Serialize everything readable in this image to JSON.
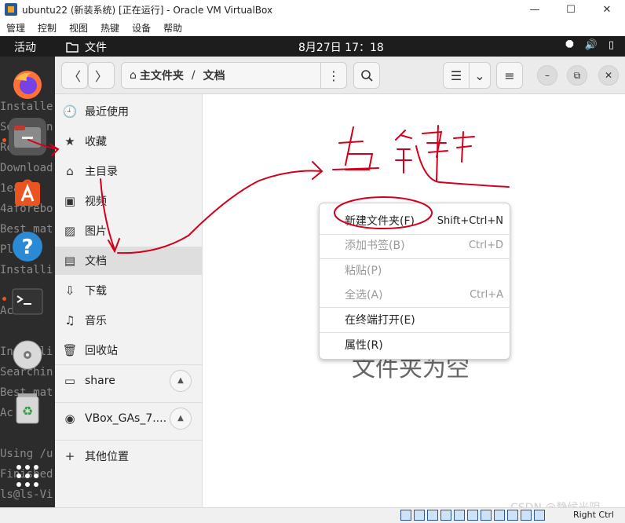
{
  "window": {
    "title": "ubuntu22 (新装系统) [正在运行] - Oracle VM VirtualBox",
    "minimize": "—",
    "maximize": "☐",
    "close": "✕"
  },
  "host_menu": [
    "管理",
    "控制",
    "视图",
    "热键",
    "设备",
    "帮助"
  ],
  "topbar": {
    "activities": "活动",
    "app_name": "文件",
    "clock": "8月27日  17：18"
  },
  "dock_ghost_text": [
    "Installe",
    "Searchin",
    "Read",
    "Download",
    "1ea",
    "4aforebo",
    "Best mat",
    "Pl",
    "Installi",
    "",
    "Ac",
    "",
    "Installi",
    "Searchin",
    "Best mat",
    "Ac",
    "",
    "Using /u",
    "Finished",
    "ls@ls-Vi"
  ],
  "header": {
    "back": "〈",
    "forward": "〉",
    "path_home": "主文件夹",
    "path_sep": "/",
    "path_current": "文档",
    "menu_dots": "⋮",
    "search": "⚲",
    "view_list": "☰",
    "view_chevron": "⌄",
    "hamburger": "≡",
    "minimize": "–",
    "restore": "⧉",
    "close": "✕"
  },
  "sidebar": {
    "items": [
      {
        "icon": "🕘",
        "label": "最近使用"
      },
      {
        "icon": "★",
        "label": "收藏"
      },
      {
        "icon": "⌂",
        "label": "主目录"
      },
      {
        "icon": "▣",
        "label": "视频"
      },
      {
        "icon": "▨",
        "label": "图片"
      },
      {
        "icon": "▤",
        "label": "文档"
      },
      {
        "icon": "⇩",
        "label": "下载"
      },
      {
        "icon": "♫",
        "label": "音乐"
      },
      {
        "icon": "🗑",
        "label": "回收站"
      },
      {
        "icon": "▭",
        "label": "share"
      },
      {
        "icon": "◉",
        "label": "VBox_GAs_7...."
      },
      {
        "icon": "+",
        "label": "其他位置"
      }
    ],
    "selected_index": 5
  },
  "main": {
    "empty_text": "文件夹为空"
  },
  "context_menu": {
    "items": [
      {
        "label": "新建文件夹(F)",
        "accel": "Shift+Ctrl+N",
        "enabled": true
      },
      {
        "label": "添加书签(B)",
        "accel": "Ctrl+D",
        "enabled": false
      },
      {
        "label": "粘贴(P)",
        "accel": "",
        "enabled": false
      },
      {
        "label": "全选(A)",
        "accel": "Ctrl+A",
        "enabled": false
      },
      {
        "label": "在终端打开(E)",
        "accel": "",
        "enabled": true
      },
      {
        "label": "属性(R)",
        "accel": "",
        "enabled": true
      }
    ]
  },
  "statusbar": {
    "right_ctrl": "Right Ctrl"
  },
  "watermark": "CSDN @静候光阴",
  "annotation_text": "右键",
  "colors": {
    "accent": "#e95420",
    "annotation": "#d3001c"
  }
}
